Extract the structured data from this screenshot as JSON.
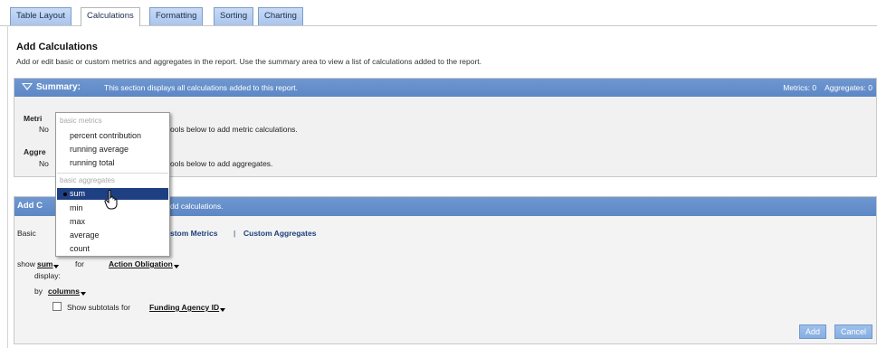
{
  "tabs": [
    {
      "label": "Table Layout"
    },
    {
      "label": "Calculations",
      "active": true
    },
    {
      "label": "Formatting"
    },
    {
      "label": "Sorting"
    },
    {
      "label": "Charting"
    }
  ],
  "page": {
    "title": "Add Calculations",
    "description": "Add or edit basic or custom metrics and aggregates in the report. Use the summary area to view a list of calculations added to the report."
  },
  "summary": {
    "heading": "Summary:",
    "heading_text": "This section displays all calculations added to this report.",
    "metrics_count_label": "Metrics: 0",
    "aggregates_count_label": "Aggregates: 0",
    "metrics_label_visible": "Metri",
    "metrics_none_visible": "No",
    "metrics_hint_visible": "ools below to add metric calculations.",
    "aggregates_label_visible": "Aggre",
    "aggregates_none_visible": "No",
    "aggregates_hint_visible": "ools below to add aggregates."
  },
  "add_panel": {
    "heading_visible": "Add C",
    "heading_text_visible": "dd calculations.",
    "basic_visible": "Basic",
    "link_custom_metrics_visible": "stom Metrics",
    "separator": "|",
    "link_custom_aggregates": "Custom Aggregates",
    "show_label": "show",
    "show_value": "sum",
    "for_label": "for",
    "for_value": "Action Obligation",
    "display_label": "display:",
    "by_label": "by",
    "by_value": "columns",
    "subtotals_label": "Show subtotals for",
    "subtotals_value": "Funding Agency ID",
    "add_button": "Add",
    "cancel_button": "Cancel"
  },
  "menu": {
    "group_metrics": "basic metrics",
    "metrics": [
      "percent contribution",
      "running average",
      "running total"
    ],
    "group_aggregates": "basic aggregates",
    "aggregates": [
      "sum",
      "min",
      "max",
      "average",
      "count"
    ],
    "selected": "sum"
  },
  "colors": {
    "panel_header": "#6f98d1",
    "menu_highlight": "#1e3f82",
    "link": "#1c3f7a"
  }
}
